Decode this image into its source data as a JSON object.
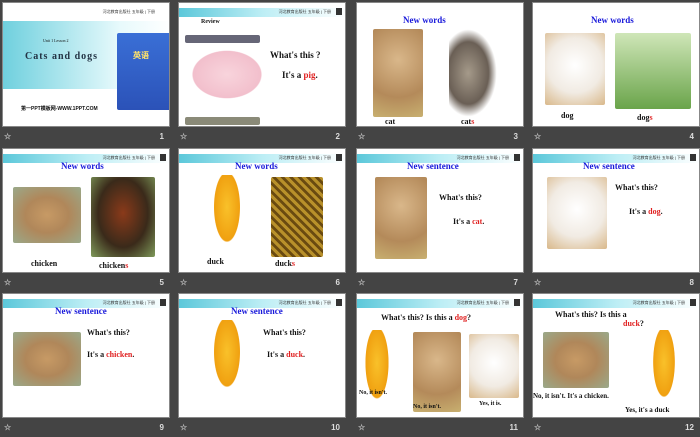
{
  "publisher_header": "河北教育出版社 五年级 | 下册",
  "slides": [
    {
      "number": "1",
      "unit": "Unit 1 Lesson 2",
      "title": "Cats and dogs",
      "book": "英语",
      "site": "第一PPT模板网-WWW.1PPT.COM"
    },
    {
      "number": "2",
      "review": "Review",
      "q": "What's this ?",
      "a_prefix": "It's a ",
      "a_word": "pig",
      "a_suffix": "."
    },
    {
      "number": "3",
      "heading": "New words",
      "left": "cat",
      "right_base": "cat",
      "right_s": "s"
    },
    {
      "number": "4",
      "heading": "New words",
      "left": "dog",
      "right_base": "dog",
      "right_s": "s"
    },
    {
      "number": "5",
      "heading": "New words",
      "left": "chicken",
      "right_base": "chicken",
      "right_s": "s"
    },
    {
      "number": "6",
      "heading": "New words",
      "left": "duck",
      "right_base": "duck",
      "right_s": "s"
    },
    {
      "number": "7",
      "heading": "New sentence",
      "q": "What's this?",
      "a_prefix": "It's a ",
      "a_word": "cat",
      "a_suffix": "."
    },
    {
      "number": "8",
      "heading": "New sentence",
      "q": "What's this?",
      "a_prefix": "It's a ",
      "a_word": "dog",
      "a_suffix": "."
    },
    {
      "number": "9",
      "heading": "New sentence",
      "q": "What's this?",
      "a_prefix": "It's a ",
      "a_word": "chicken",
      "a_suffix": "."
    },
    {
      "number": "10",
      "heading": "New sentence",
      "q": "What's this?",
      "a_prefix": "It's a ",
      "a_word": "duck",
      "a_suffix": "."
    },
    {
      "number": "11",
      "q_prefix": "What's this?  Is this a ",
      "q_word": "dog",
      "q_suffix": "?",
      "ans1": "No, it isn't.",
      "ans2": "No, it isn't.",
      "ans3": "Yes, it is."
    },
    {
      "number": "12",
      "q_prefix": "What's this? Is this a",
      "q_word": "duck",
      "q_suffix": "?",
      "ans1": "No, it isn't. It's a chicken.",
      "ans2": "Yes, it's a duck"
    }
  ]
}
